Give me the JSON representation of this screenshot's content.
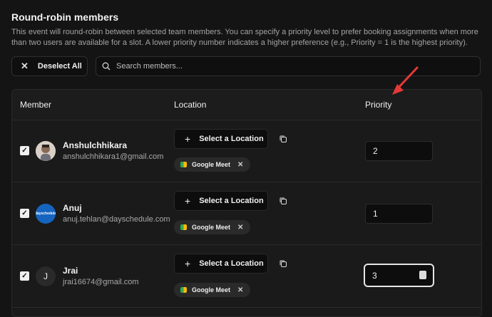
{
  "section": {
    "title": "Round-robin members",
    "description": "This event will round-robin between selected team members. You can specify a priority level to prefer booking assignments when more than two users are available for a slot. A lower priority number indicates a higher preference (e.g., Priority = 1 is the highest priority)."
  },
  "toolbar": {
    "deselect_label": "Deselect All",
    "search_placeholder": "Search members..."
  },
  "table": {
    "headers": {
      "member": "Member",
      "location": "Location",
      "priority": "Priority"
    },
    "rows": [
      {
        "name": "Anshulchhikara",
        "email": "anshulchhikara1@gmail.com",
        "location_button": "Select a Location",
        "chip": "Google Meet",
        "priority": "2"
      },
      {
        "name": "Anuj",
        "email": "anuj.tehlan@dayschedule.com",
        "location_button": "Select a Location",
        "chip": "Google Meet",
        "priority": "1",
        "avatar_text": "dayschedule"
      },
      {
        "name": "Jrai",
        "email": "jrai16674@gmail.com",
        "location_button": "Select a Location",
        "chip": "Google Meet",
        "priority": "3",
        "avatar_initial": "J"
      }
    ]
  },
  "colors": {
    "background": "#141414",
    "annotation_arrow": "#e53935",
    "avatar_anuj": "#1565c0"
  },
  "icons": [
    "x-icon",
    "search-icon",
    "check-icon",
    "plus-icon",
    "copy-icon",
    "google-meet-icon",
    "spinner-icon"
  ]
}
